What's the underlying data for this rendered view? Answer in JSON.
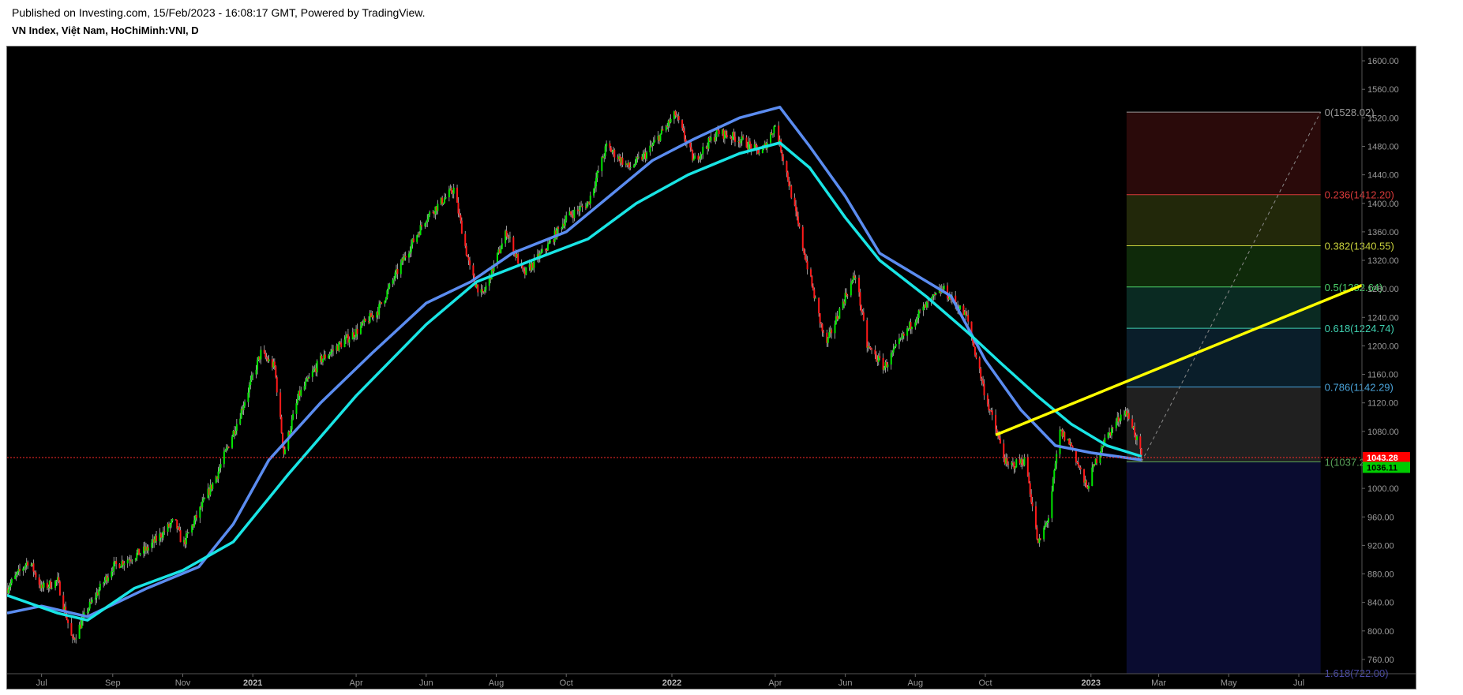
{
  "header": {
    "published": "Published on Investing.com, 15/Feb/2023 - 16:08:17 GMT, Powered by TradingView.",
    "symbol": "VN Index, Việt Nam, HoChiMinh:VNI, D"
  },
  "colors": {
    "background": "#000000",
    "up_candle": "#00e600",
    "down_candle": "#ff1a1a",
    "ma_fast": "#5b8cf0",
    "ma_slow": "#19e5e5",
    "trendline": "#ffff00",
    "current_price_line": "#ff2a2a",
    "current_price_badge": "#ff0000",
    "fib_base_badge": "#00cc00"
  },
  "chart_data": {
    "type": "candlestick",
    "title": "VN Index, Việt Nam, HoChiMinh:VNI, D",
    "ylim": [
      740,
      1620
    ],
    "yticks": [
      760,
      800,
      840,
      880,
      920,
      960,
      1000,
      1040,
      1080,
      1120,
      1160,
      1200,
      1240,
      1280,
      1320,
      1360,
      1400,
      1440,
      1480,
      1520,
      1560,
      1600
    ],
    "ytick_labels": [
      "760.00",
      "800.00",
      "840.00",
      "880.00",
      "920.00",
      "960.00",
      "1000.00",
      "1040.00",
      "1080.00",
      "1120.00",
      "1160.00",
      "1200.00",
      "1240.00",
      "1280.00",
      "1320.00",
      "1360.00",
      "1400.00",
      "1440.00",
      "1480.00",
      "1520.00",
      "1560.00",
      "1600.00"
    ],
    "xlim": [
      "2020-06-01",
      "2023-08-25"
    ],
    "xticks": [
      {
        "date": "2020-07-01",
        "label": "Jul",
        "bold": false
      },
      {
        "date": "2020-09-01",
        "label": "Sep",
        "bold": false
      },
      {
        "date": "2020-11-01",
        "label": "Nov",
        "bold": false
      },
      {
        "date": "2021-01-01",
        "label": "2021",
        "bold": true
      },
      {
        "date": "2021-04-01",
        "label": "Apr",
        "bold": false
      },
      {
        "date": "2021-06-01",
        "label": "Jun",
        "bold": false
      },
      {
        "date": "2021-08-01",
        "label": "Aug",
        "bold": false
      },
      {
        "date": "2021-10-01",
        "label": "Oct",
        "bold": false
      },
      {
        "date": "2022-01-01",
        "label": "2022",
        "bold": true
      },
      {
        "date": "2022-04-01",
        "label": "Apr",
        "bold": false
      },
      {
        "date": "2022-06-01",
        "label": "Jun",
        "bold": false
      },
      {
        "date": "2022-08-01",
        "label": "Aug",
        "bold": false
      },
      {
        "date": "2022-10-01",
        "label": "Oct",
        "bold": false
      },
      {
        "date": "2023-01-01",
        "label": "2023",
        "bold": true
      },
      {
        "date": "2023-03-01",
        "label": "Mar",
        "bold": false
      },
      {
        "date": "2023-05-01",
        "label": "May",
        "bold": false
      },
      {
        "date": "2023-07-01",
        "label": "Jul",
        "bold": false
      }
    ],
    "price_path": [
      [
        "2020-06-01",
        860
      ],
      [
        "2020-06-20",
        900
      ],
      [
        "2020-07-01",
        860
      ],
      [
        "2020-07-15",
        870
      ],
      [
        "2020-07-28",
        785
      ],
      [
        "2020-08-10",
        830
      ],
      [
        "2020-09-01",
        890
      ],
      [
        "2020-10-01",
        915
      ],
      [
        "2020-10-25",
        955
      ],
      [
        "2020-11-01",
        920
      ],
      [
        "2020-12-01",
        1020
      ],
      [
        "2020-12-20",
        1100
      ],
      [
        "2021-01-08",
        1190
      ],
      [
        "2021-01-20",
        1170
      ],
      [
        "2021-01-28",
        1050
      ],
      [
        "2021-02-10",
        1130
      ],
      [
        "2021-03-01",
        1180
      ],
      [
        "2021-04-01",
        1220
      ],
      [
        "2021-04-20",
        1250
      ],
      [
        "2021-05-15",
        1330
      ],
      [
        "2021-06-01",
        1380
      ],
      [
        "2021-06-25",
        1420
      ],
      [
        "2021-07-10",
        1300
      ],
      [
        "2021-07-20",
        1270
      ],
      [
        "2021-08-10",
        1360
      ],
      [
        "2021-08-25",
        1300
      ],
      [
        "2021-09-15",
        1340
      ],
      [
        "2021-10-01",
        1380
      ],
      [
        "2021-10-20",
        1400
      ],
      [
        "2021-11-05",
        1480
      ],
      [
        "2021-11-25",
        1450
      ],
      [
        "2021-12-10",
        1470
      ],
      [
        "2022-01-04",
        1525
      ],
      [
        "2022-01-20",
        1460
      ],
      [
        "2022-02-10",
        1500
      ],
      [
        "2022-03-01",
        1490
      ],
      [
        "2022-03-20",
        1470
      ],
      [
        "2022-04-01",
        1510
      ],
      [
        "2022-04-10",
        1450
      ],
      [
        "2022-04-25",
        1340
      ],
      [
        "2022-05-15",
        1200
      ],
      [
        "2022-06-01",
        1270
      ],
      [
        "2022-06-10",
        1300
      ],
      [
        "2022-06-20",
        1200
      ],
      [
        "2022-07-05",
        1170
      ],
      [
        "2022-08-01",
        1240
      ],
      [
        "2022-08-25",
        1280
      ],
      [
        "2022-09-15",
        1240
      ],
      [
        "2022-10-01",
        1130
      ],
      [
        "2022-10-20",
        1030
      ],
      [
        "2022-11-05",
        1040
      ],
      [
        "2022-11-16",
        920
      ],
      [
        "2022-11-25",
        960
      ],
      [
        "2022-12-05",
        1080
      ],
      [
        "2022-12-15",
        1060
      ],
      [
        "2022-12-28",
        1000
      ],
      [
        "2023-01-10",
        1060
      ],
      [
        "2023-01-30",
        1110
      ],
      [
        "2023-02-06",
        1090
      ],
      [
        "2023-02-14",
        1043
      ]
    ],
    "series": [
      {
        "name": "",
        "color": "#5b8cf0",
        "points": [
          [
            "2020-06-01",
            825
          ],
          [
            "2020-07-01",
            835
          ],
          [
            "2020-08-10",
            820
          ],
          [
            "2020-10-01",
            860
          ],
          [
            "2020-11-15",
            890
          ],
          [
            "2020-12-15",
            950
          ],
          [
            "2021-01-15",
            1040
          ],
          [
            "2021-03-01",
            1120
          ],
          [
            "2021-04-15",
            1190
          ],
          [
            "2021-06-01",
            1260
          ],
          [
            "2021-07-10",
            1290
          ],
          [
            "2021-08-15",
            1330
          ],
          [
            "2021-10-01",
            1360
          ],
          [
            "2021-11-15",
            1420
          ],
          [
            "2021-12-15",
            1460
          ],
          [
            "2022-01-20",
            1490
          ],
          [
            "2022-03-01",
            1520
          ],
          [
            "2022-04-05",
            1535
          ],
          [
            "2022-05-01",
            1480
          ],
          [
            "2022-06-01",
            1410
          ],
          [
            "2022-07-01",
            1330
          ],
          [
            "2022-08-01",
            1300
          ],
          [
            "2022-09-01",
            1270
          ],
          [
            "2022-10-01",
            1180
          ],
          [
            "2022-11-01",
            1110
          ],
          [
            "2022-12-01",
            1060
          ],
          [
            "2023-01-01",
            1050
          ],
          [
            "2023-02-14",
            1040
          ]
        ]
      },
      {
        "name": "",
        "color": "#19e5e5",
        "points": [
          [
            "2020-06-01",
            850
          ],
          [
            "2020-07-15",
            825
          ],
          [
            "2020-08-10",
            815
          ],
          [
            "2020-09-20",
            860
          ],
          [
            "2020-11-01",
            885
          ],
          [
            "2020-12-15",
            925
          ],
          [
            "2021-02-01",
            1020
          ],
          [
            "2021-04-01",
            1130
          ],
          [
            "2021-06-01",
            1230
          ],
          [
            "2021-07-15",
            1290
          ],
          [
            "2021-09-01",
            1320
          ],
          [
            "2021-10-20",
            1350
          ],
          [
            "2021-12-01",
            1400
          ],
          [
            "2022-01-15",
            1440
          ],
          [
            "2022-03-01",
            1470
          ],
          [
            "2022-04-05",
            1485
          ],
          [
            "2022-05-01",
            1450
          ],
          [
            "2022-06-01",
            1380
          ],
          [
            "2022-07-01",
            1320
          ],
          [
            "2022-08-10",
            1270
          ],
          [
            "2022-09-15",
            1220
          ],
          [
            "2022-10-15",
            1175
          ],
          [
            "2022-11-15",
            1130
          ],
          [
            "2022-12-15",
            1090
          ],
          [
            "2023-01-15",
            1060
          ],
          [
            "2023-02-14",
            1045
          ]
        ]
      }
    ],
    "trendline": [
      [
        "2022-10-10",
        1075
      ],
      [
        "2023-08-25",
        1285
      ]
    ],
    "fib_projection": [
      [
        "2023-02-14",
        1037.27
      ],
      [
        "2023-07-20",
        1528.02
      ]
    ],
    "fib_region": {
      "start": "2023-02-01",
      "end": "2023-07-20"
    },
    "fib_levels": [
      {
        "label": "0(1528.02)",
        "value": 1528.02,
        "color": "#9a9a9a",
        "fill": "#2a0a0a"
      },
      {
        "label": "0.236(1412.20)",
        "value": 1412.2,
        "color": "#d93a3a",
        "fill": "#22280a"
      },
      {
        "label": "0.382(1340.55)",
        "value": 1340.55,
        "color": "#c8d13c",
        "fill": "#0f2a0a"
      },
      {
        "label": "0.5(1282.64)",
        "value": 1282.64,
        "color": "#4bd16a",
        "fill": "#0a2a22"
      },
      {
        "label": "0.618(1224.74)",
        "value": 1224.74,
        "color": "#3fd0b0",
        "fill": "#0a1e2a"
      },
      {
        "label": "0.786(1142.29)",
        "value": 1142.29,
        "color": "#4aa3d9",
        "fill": "#202020"
      },
      {
        "label": "1(1037.27)",
        "value": 1037.27,
        "color": "#5aa35a",
        "fill": "#0a0c30"
      },
      {
        "label": "1.618(722.00)",
        "value": 722.0,
        "color": "#4a4aa8",
        "fill": null
      }
    ],
    "current_price": 1043.28,
    "current_price_label": "1043.28",
    "fib_base_label": "1036.11"
  }
}
